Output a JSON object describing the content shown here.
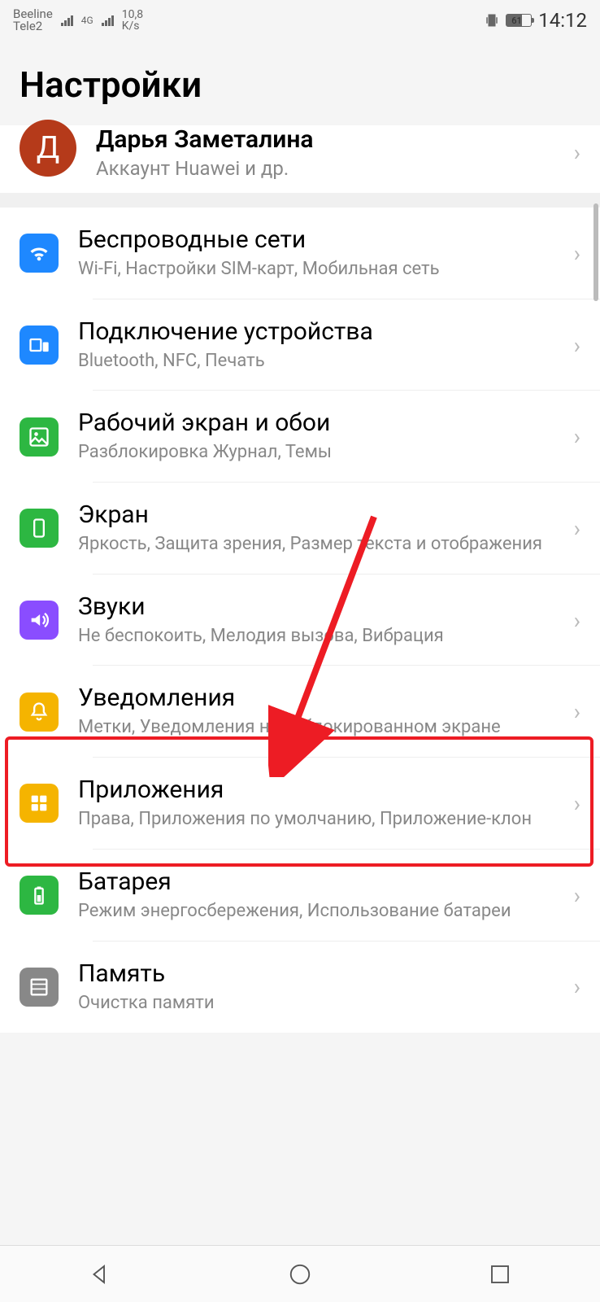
{
  "status": {
    "carrier1": "Beeline",
    "carrier2": "Tele2",
    "network_type": "4G",
    "speed_value": "10,8",
    "speed_unit": "K/s",
    "battery_pct": "61",
    "time": "14:12"
  },
  "page_title": "Настройки",
  "account": {
    "initial": "Д",
    "name": "Дарья Заметалина",
    "sub": "Аккаунт Huawei и др."
  },
  "items": [
    {
      "icon": "wifi",
      "color": "#1e88ff",
      "title": "Беспроводные сети",
      "sub": "Wi-Fi, Настройки SIM-карт, Мобильная сеть"
    },
    {
      "icon": "devices",
      "color": "#1e88ff",
      "title": "Подключение устройства",
      "sub": "Bluetooth, NFC, Печать"
    },
    {
      "icon": "image",
      "color": "#2db742",
      "title": "Рабочий экран и обои",
      "sub": "Разблокировка Журнал, Темы"
    },
    {
      "icon": "phone",
      "color": "#2db742",
      "title": "Экран",
      "sub": "Яркость, Защита зрения, Размер текста и отображения"
    },
    {
      "icon": "sound",
      "color": "#8a4dff",
      "title": "Звуки",
      "sub": "Не беспокоить, Мелодия вызова, Вибрация"
    },
    {
      "icon": "bell",
      "color": "#f5b400",
      "title": "Уведомления",
      "sub": "Метки, Уведомления на заблокированном экране"
    },
    {
      "icon": "apps",
      "color": "#f5b400",
      "title": "Приложения",
      "sub": "Права, Приложения по умолчанию, Приложение-клон"
    },
    {
      "icon": "battery",
      "color": "#2db742",
      "title": "Батарея",
      "sub": "Режим энергосбережения, Использование батареи"
    },
    {
      "icon": "storage",
      "color": "#888888",
      "title": "Память",
      "sub": "Очистка памяти"
    }
  ],
  "annotation": {
    "highlighted_item_index": 5,
    "arrow_color": "#ed1c24"
  }
}
